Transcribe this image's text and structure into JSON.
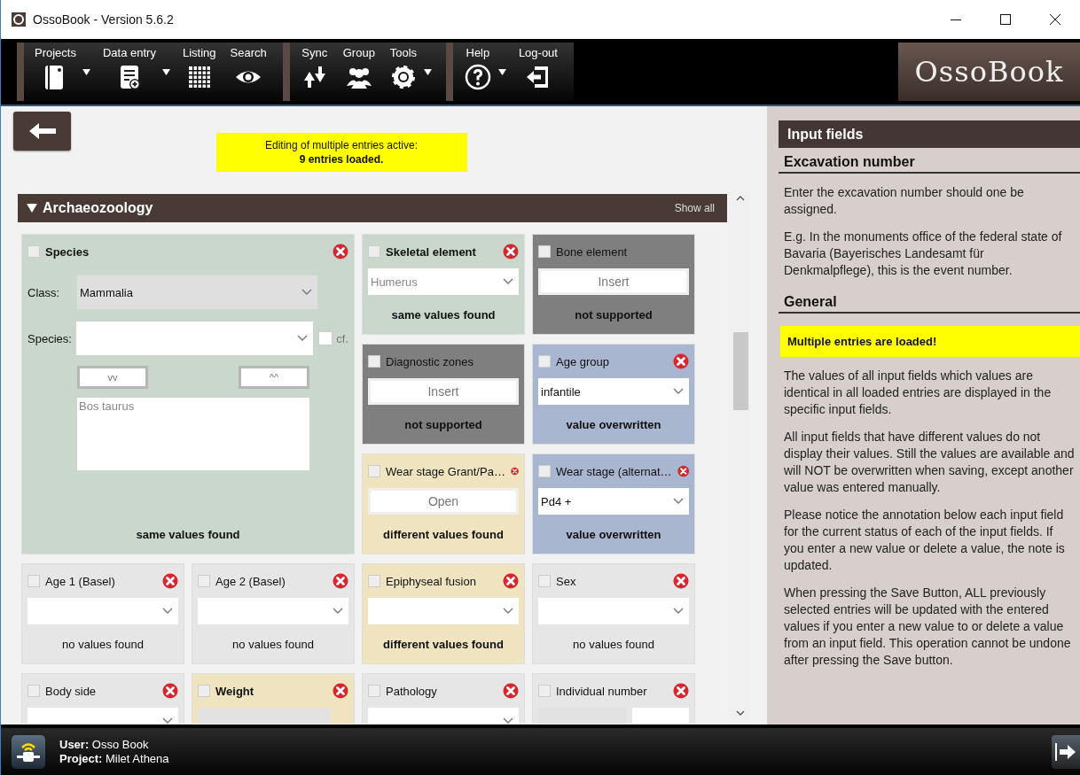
{
  "window": {
    "title": "OssoBook - Version 5.6.2"
  },
  "toolbar": {
    "groups": [
      {
        "items": [
          {
            "label": "Projects",
            "has_menu": true
          },
          {
            "label": "Data entry",
            "has_menu": true
          },
          {
            "label": "Listing",
            "has_menu": false
          },
          {
            "label": "Search",
            "has_menu": false
          }
        ]
      },
      {
        "items": [
          {
            "label": "Sync",
            "has_menu": false
          },
          {
            "label": "Group",
            "has_menu": false
          },
          {
            "label": "Tools",
            "has_menu": true
          }
        ]
      },
      {
        "items": [
          {
            "label": "Help",
            "has_menu": true
          },
          {
            "label": "Log-out",
            "has_menu": false
          }
        ]
      }
    ],
    "logo": "OssoBook"
  },
  "notice": {
    "line_1": "Editing of multiple entries active:",
    "line_2": "9 entries loaded."
  },
  "section": {
    "title": "Archaeozoology",
    "expanded": true,
    "action": "Show all"
  },
  "species_card": {
    "title": "Species",
    "checked": false,
    "bold": true,
    "color": "#c9d7cc",
    "class_label": "Class:",
    "class_value": "Mammalia",
    "species_label": "Species:",
    "cf_label": "cf.",
    "cf_checked": false,
    "down_button": "vv",
    "up_button": "^^",
    "list_items": [
      "Bos taurus"
    ],
    "note": "same values found"
  },
  "cards": [
    {
      "title": "Skeletal element",
      "checked": false,
      "bold": true,
      "removable": true,
      "color": "#c9d7cc",
      "control": {
        "kind": "dropdown",
        "value": "Humerus",
        "muted": true
      },
      "note": "same values found",
      "note_bold": true
    },
    {
      "title": "Bone element",
      "checked": false,
      "bold": false,
      "removable": false,
      "color": "#7f7f7f",
      "control": {
        "kind": "button",
        "value": "Insert"
      },
      "note": "not supported",
      "note_bold": true
    },
    {
      "title": "Diagnostic zones",
      "checked": false,
      "bold": false,
      "removable": false,
      "color": "#7f7f7f",
      "control": {
        "kind": "button",
        "value": "Insert"
      },
      "note": "not supported",
      "note_bold": true
    },
    {
      "title": "Age group",
      "checked": false,
      "bold": false,
      "removable": true,
      "color": "#a8b6cf",
      "control": {
        "kind": "dropdown",
        "value": "infantile",
        "muted": false
      },
      "note": "value overwritten",
      "note_bold": true
    },
    {
      "title": "Wear stage Grant/Pa…",
      "checked": false,
      "bold": false,
      "removable": true,
      "color": "#efe4bf",
      "control": {
        "kind": "button",
        "value": "Open"
      },
      "note": "different values found",
      "note_bold": true
    },
    {
      "title": "Wear stage (alternat…",
      "checked": false,
      "bold": false,
      "removable": true,
      "color": "#a8b6cf",
      "control": {
        "kind": "dropdown",
        "value": "Pd4 +",
        "muted": false
      },
      "note": "value overwritten",
      "note_bold": true
    },
    {
      "title": "Age 1 (Basel)",
      "checked": false,
      "bold": false,
      "removable": true,
      "color": "#e6e6e6",
      "control": {
        "kind": "dropdown"
      },
      "note": "no values found",
      "note_bold": false
    },
    {
      "title": "Age 2 (Basel)",
      "checked": false,
      "bold": false,
      "removable": true,
      "color": "#e6e6e6",
      "control": {
        "kind": "dropdown"
      },
      "note": "no values found",
      "note_bold": false
    },
    {
      "title": "Epiphyseal fusion",
      "checked": false,
      "bold": false,
      "removable": true,
      "color": "#efe4bf",
      "control": {
        "kind": "dropdown"
      },
      "note": "different values found",
      "note_bold": true
    },
    {
      "title": "Sex",
      "checked": false,
      "bold": false,
      "removable": true,
      "color": "#e6e6e6",
      "control": {
        "kind": "dropdown"
      },
      "note": "no values found",
      "note_bold": false
    },
    {
      "title": "Body side",
      "checked": false,
      "bold": false,
      "removable": true,
      "color": "#e6e6e6",
      "control": {
        "kind": "dropdown"
      }
    },
    {
      "title": "Weight",
      "checked": false,
      "bold": true,
      "removable": true,
      "color": "#efe4bf",
      "control": {
        "kind": "field"
      }
    },
    {
      "title": "Pathology",
      "checked": false,
      "bold": false,
      "removable": true,
      "color": "#e6e6e6",
      "control": {
        "kind": "dropdown"
      }
    },
    {
      "title": "Individual number",
      "checked": false,
      "bold": false,
      "removable": true,
      "color": "#e6e6e6",
      "control": {
        "kind": "pair"
      }
    }
  ],
  "help": {
    "title": "Input fields",
    "sections": [
      {
        "heading": "Excavation number",
        "blocks": [
          {
            "kind": "text",
            "text": "Enter the excavation number should one be assigned."
          },
          {
            "kind": "text",
            "text": "E.g. In the monuments office of the federal state of Bavaria (Bayerisches Landesamt für Denkmalpflege), this is the event number."
          }
        ]
      },
      {
        "heading": "General",
        "blocks": [
          {
            "kind": "alert",
            "text": "Multiple entries are loaded!"
          },
          {
            "kind": "text",
            "text": "The values of all input fields which values are identical in all loaded entries are displayed in the specific input fields."
          },
          {
            "kind": "text",
            "text": "All input fields that have different values do not display their values. Still the values are available and will NOT be overwritten when saving, except another value was entered manually."
          },
          {
            "kind": "text",
            "text": "Please notice the annotation below each input field for the current status of each of the input fields. If you enter a new value or delete a value, the note is updated."
          },
          {
            "kind": "text",
            "text": "When pressing the Save Button, ALL previously selected entries will be updated with the entered values if you enter a new value to or delete a value from an input field. This operation cannot be undone after pressing the Save button."
          }
        ]
      }
    ]
  },
  "status_bar": {
    "user": "**User:** Osso Book",
    "project": "**Project:** Milet Athena"
  }
}
